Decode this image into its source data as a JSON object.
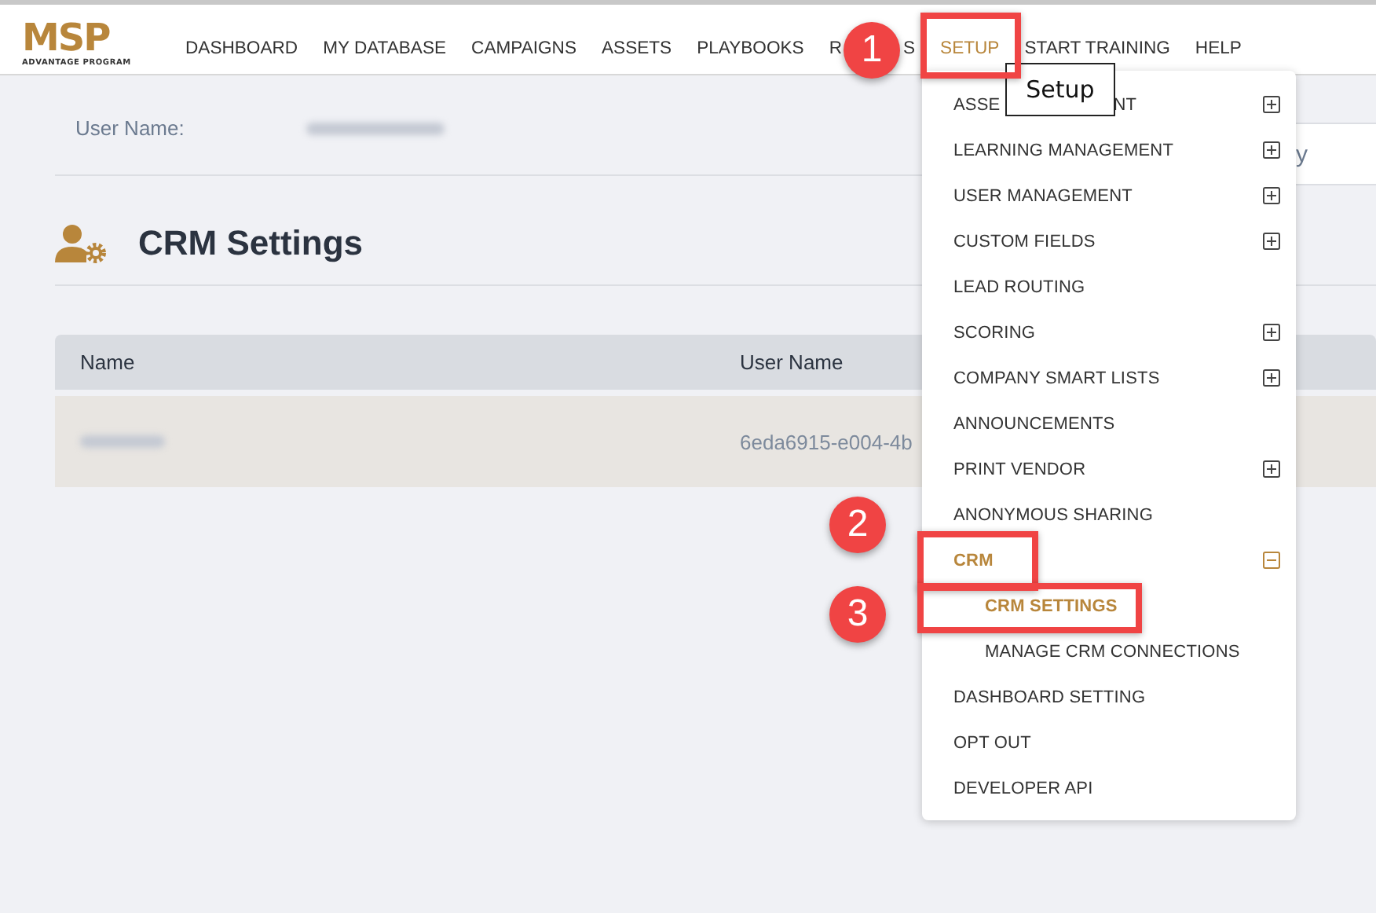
{
  "logo": {
    "mark": "MSP",
    "tagline": "ADVANTAGE PROGRAM"
  },
  "nav": [
    {
      "label": "DASHBOARD",
      "selected": false
    },
    {
      "label": "MY DATABASE",
      "selected": false
    },
    {
      "label": "CAMPAIGNS",
      "selected": false
    },
    {
      "label": "ASSETS",
      "selected": false
    },
    {
      "label": "PLAYBOOKS",
      "selected": false
    },
    {
      "label_start": "R",
      "label_end": "S",
      "selected": false
    },
    {
      "label": "SETUP",
      "selected": true
    },
    {
      "label": "START TRAINING",
      "selected": false
    },
    {
      "label": "HELP",
      "selected": false
    }
  ],
  "tooltip": "Setup",
  "profile": {
    "label": "User Name:"
  },
  "partial_field": {
    "text": "y"
  },
  "page_title": "CRM Settings",
  "table": {
    "columns": [
      "Name",
      "User Name"
    ],
    "rows": [
      {
        "user_name": "6eda6915-e004-4b"
      }
    ]
  },
  "menu": [
    {
      "kind": "group",
      "label_start": "ASSE",
      "label_end": "NT",
      "expanded": false,
      "selected": false
    },
    {
      "kind": "group",
      "label": "LEARNING MANAGEMENT",
      "expanded": false,
      "selected": false
    },
    {
      "kind": "group",
      "label": "USER MANAGEMENT",
      "expanded": false,
      "selected": false
    },
    {
      "kind": "group",
      "label": "CUSTOM FIELDS",
      "expanded": false,
      "selected": false
    },
    {
      "kind": "link",
      "label": "LEAD ROUTING",
      "selected": false
    },
    {
      "kind": "group",
      "label": "SCORING",
      "expanded": false,
      "selected": false
    },
    {
      "kind": "group",
      "label": "COMPANY SMART LISTS",
      "expanded": false,
      "selected": false
    },
    {
      "kind": "link",
      "label": "ANNOUNCEMENTS",
      "selected": false
    },
    {
      "kind": "group",
      "label": "PRINT VENDOR",
      "expanded": false,
      "selected": false
    },
    {
      "kind": "link",
      "label": "ANONYMOUS SHARING",
      "selected": false
    },
    {
      "kind": "group",
      "label": "CRM",
      "expanded": true,
      "selected": true,
      "children": [
        {
          "kind": "link",
          "label": "CRM SETTINGS",
          "selected": true
        },
        {
          "kind": "link",
          "label": "MANAGE CRM CONNECTIONS",
          "selected": false
        }
      ]
    },
    {
      "kind": "link",
      "label": "DASHBOARD SETTING",
      "selected": false
    },
    {
      "kind": "link",
      "label": "OPT OUT",
      "selected": false
    },
    {
      "kind": "link",
      "label": "DEVELOPER API",
      "selected": false
    }
  ],
  "annotations": [
    {
      "number": "1"
    },
    {
      "number": "2"
    },
    {
      "number": "3"
    }
  ]
}
